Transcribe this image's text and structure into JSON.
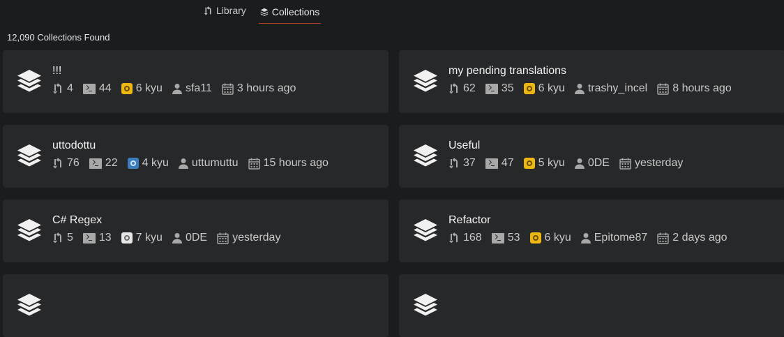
{
  "tabs": [
    {
      "label": "Library",
      "icon": "fork-icon",
      "active": false
    },
    {
      "label": "Collections",
      "icon": "layers-icon",
      "active": true
    }
  ],
  "results_count": "12,090 Collections Found",
  "collections": [
    {
      "title": "!!!",
      "forks": "4",
      "katas": "44",
      "rank": "6 kyu",
      "rank_color": "yellow",
      "author": "sfa11",
      "updated": "3 hours ago"
    },
    {
      "title": "my pending translations",
      "forks": "62",
      "katas": "35",
      "rank": "6 kyu",
      "rank_color": "yellow",
      "author": "trashy_incel",
      "updated": "8 hours ago"
    },
    {
      "title": "uttodottu",
      "forks": "76",
      "katas": "22",
      "rank": "4 kyu",
      "rank_color": "blue",
      "author": "uttumuttu",
      "updated": "15 hours ago"
    },
    {
      "title": "Useful",
      "forks": "37",
      "katas": "47",
      "rank": "5 kyu",
      "rank_color": "yellow",
      "author": "0DE",
      "updated": "yesterday"
    },
    {
      "title": "C# Regex",
      "forks": "5",
      "katas": "13",
      "rank": "7 kyu",
      "rank_color": "white",
      "author": "0DE",
      "updated": "yesterday"
    },
    {
      "title": "Refactor",
      "forks": "168",
      "katas": "53",
      "rank": "6 kyu",
      "rank_color": "yellow",
      "author": "Epitome87",
      "updated": "2 days ago"
    },
    {
      "title": "",
      "forks": "",
      "katas": "",
      "rank": "",
      "rank_color": "white",
      "author": "",
      "updated": ""
    },
    {
      "title": "",
      "forks": "",
      "katas": "",
      "rank": "",
      "rank_color": "white",
      "author": "",
      "updated": ""
    }
  ]
}
